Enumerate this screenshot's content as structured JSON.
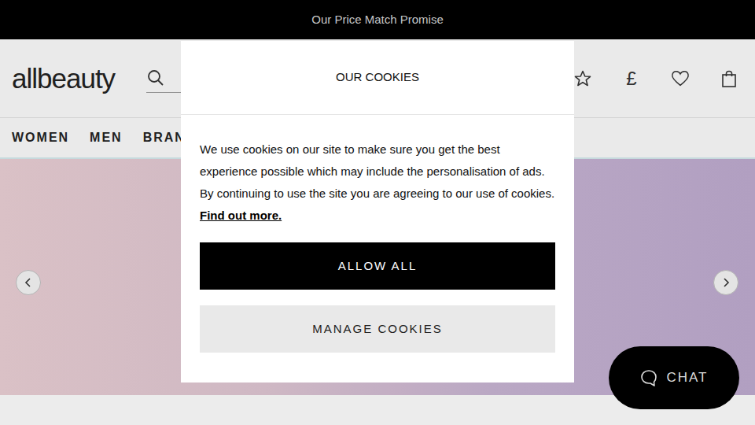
{
  "promo_bar": {
    "text": "Our Price Match Promise"
  },
  "logo": {
    "text": "allbeauty"
  },
  "header_icons": {
    "currency": "£"
  },
  "nav": {
    "items": [
      {
        "label": "WOMEN"
      },
      {
        "label": "MEN"
      },
      {
        "label": "BRAN"
      }
    ]
  },
  "chat": {
    "label": "CHAT"
  },
  "cookie_dialog": {
    "title": "OUR COOKIES",
    "text": "We use cookies on our site to make sure you get the best experience possible which may include the personalisation of ads. By continuing to use the site you are agreeing to our use of cookies.",
    "link": "Find out more.",
    "buttons": [
      "ALLOW ALL",
      "MANAGE COOKIES"
    ]
  }
}
